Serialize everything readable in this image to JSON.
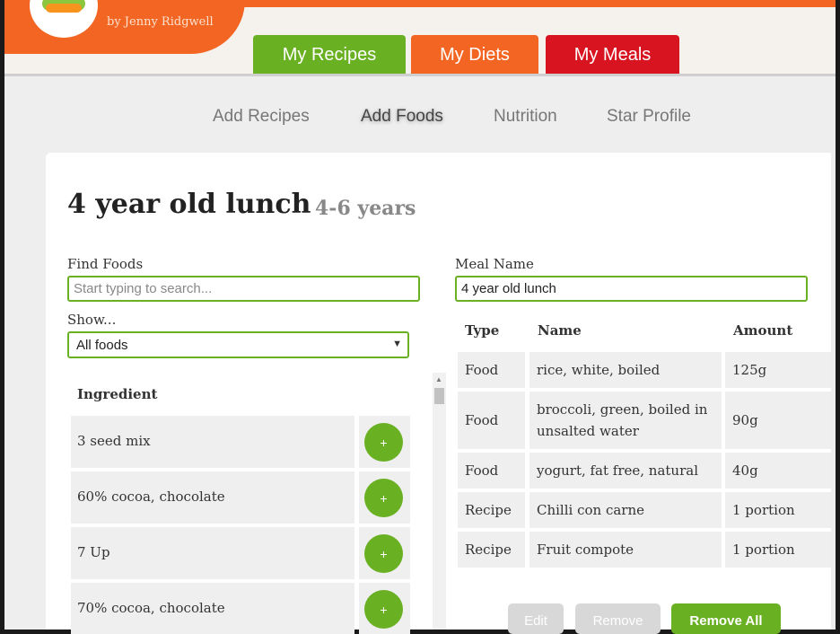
{
  "header": {
    "byline": "by Jenny Ridgwell",
    "tabs": [
      "My Recipes",
      "My Diets",
      "My Meals"
    ]
  },
  "subnav": [
    "Add Recipes",
    "Add Foods",
    "Nutrition",
    "Star Profile"
  ],
  "meal": {
    "title": "4 year old lunch",
    "age_group": "4-6 years"
  },
  "find_foods": {
    "label": "Find Foods",
    "placeholder": "Start typing to search..."
  },
  "show": {
    "label": "Show...",
    "selected": "All foods"
  },
  "meal_name": {
    "label": "Meal Name",
    "value": "4 year old lunch"
  },
  "ingredients": {
    "header": "Ingredient",
    "add_label": "+",
    "items": [
      "3 seed mix",
      "60% cocoa, chocolate",
      "7 Up",
      "70% cocoa, chocolate"
    ]
  },
  "meal_table": {
    "headers": [
      "Type",
      "Name",
      "Amount"
    ],
    "rows": [
      {
        "type": "Food",
        "name": "rice, white, boiled",
        "amount": "125g"
      },
      {
        "type": "Food",
        "name": "broccoli, green, boiled in unsalted water",
        "amount": "90g"
      },
      {
        "type": "Food",
        "name": "yogurt, fat free, natural",
        "amount": "40g"
      },
      {
        "type": "Recipe",
        "name": "Chilli con carne",
        "amount": "1 portion"
      },
      {
        "type": "Recipe",
        "name": "Fruit compote",
        "amount": "1 portion"
      }
    ]
  },
  "actions": {
    "edit": "Edit",
    "remove": "Remove",
    "remove_all": "Remove All"
  },
  "colors": {
    "green": "#6ab023",
    "orange": "#f26522",
    "red": "#d7141f"
  }
}
